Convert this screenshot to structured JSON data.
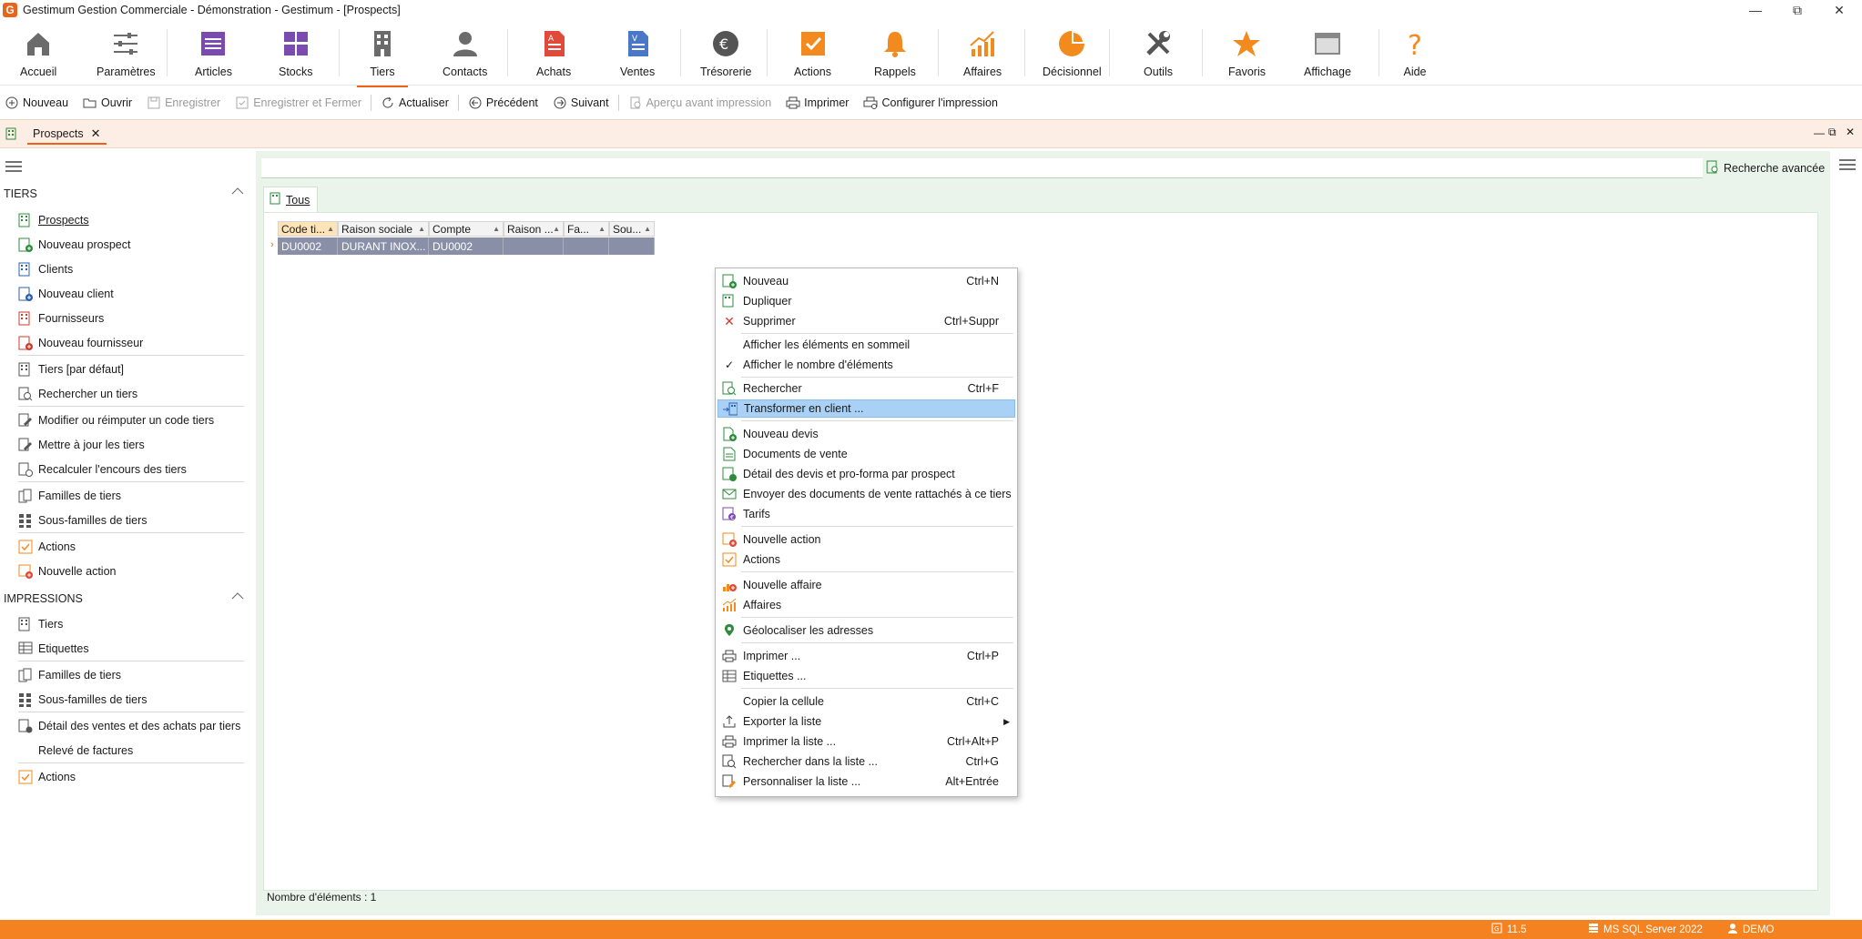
{
  "window": {
    "title": "Gestimum Gestion Commerciale - Démonstration - Gestimum - [Prospects]",
    "logo_letter": "G"
  },
  "ribbon": {
    "accueil": "Accueil",
    "parametres": "Paramètres",
    "articles": "Articles",
    "stocks": "Stocks",
    "tiers": "Tiers",
    "contacts": "Contacts",
    "achats": "Achats",
    "ventes": "Ventes",
    "tresorerie": "Trésorerie",
    "actions": "Actions",
    "rappels": "Rappels",
    "affaires": "Affaires",
    "decisionnel": "Décisionnel",
    "outils": "Outils",
    "favoris": "Favoris",
    "affichage": "Affichage",
    "aide": "Aide"
  },
  "toolbar": {
    "nouveau": "Nouveau",
    "ouvrir": "Ouvrir",
    "enregistrer": "Enregistrer",
    "enregistrer_fermer": "Enregistrer et Fermer",
    "actualiser": "Actualiser",
    "precedent": "Précédent",
    "suivant": "Suivant",
    "apercu": "Aperçu avant impression",
    "imprimer": "Imprimer",
    "configurer": "Configurer l'impression"
  },
  "doc_tab": {
    "label": "Prospects"
  },
  "sidebar": {
    "section_tiers": "TIERS",
    "section_impressions": "IMPRESSIONS",
    "tiers_items": {
      "prospects": "Prospects",
      "nouveau_prospect": "Nouveau prospect",
      "clients": "Clients",
      "nouveau_client": "Nouveau client",
      "fournisseurs": "Fournisseurs",
      "nouveau_fournisseur": "Nouveau fournisseur",
      "tiers_defaut": "Tiers [par défaut]",
      "rechercher_tiers": "Rechercher un tiers",
      "modifier_code": "Modifier ou réimputer un code tiers",
      "mettre_a_jour": "Mettre à jour les tiers",
      "recalculer": "Recalculer l'encours des tiers",
      "familles": "Familles de tiers",
      "sous_familles": "Sous-familles de tiers",
      "actions": "Actions",
      "nouvelle_action": "Nouvelle action"
    },
    "impressions_items": {
      "tiers": "Tiers",
      "etiquettes": "Etiquettes",
      "familles": "Familles de tiers",
      "sous_familles": "Sous-familles de tiers",
      "detail_ventes": "Détail des ventes et des achats par tiers",
      "releve": "Relevé de factures",
      "actions": "Actions"
    }
  },
  "search": {
    "advanced_label": "Recherche avancée"
  },
  "view_tab": {
    "label": "Tous"
  },
  "grid": {
    "columns": [
      "Code ti...",
      "Raison sociale",
      "Compte",
      "Raison ...",
      "Fa...",
      "Sou..."
    ],
    "row": [
      "DU0002",
      "DURANT INOX...",
      "DU0002",
      "",
      "",
      ""
    ]
  },
  "count_label": "Nombre d'éléments : 1",
  "context_menu": {
    "nouveau": {
      "label": "Nouveau",
      "shortcut": "Ctrl+N"
    },
    "dupliquer": {
      "label": "Dupliquer"
    },
    "supprimer": {
      "label": "Supprimer",
      "shortcut": "Ctrl+Suppr"
    },
    "afficher_sommeil": {
      "label": "Afficher les éléments en sommeil"
    },
    "afficher_nombre": {
      "label": "Afficher le nombre d'éléments"
    },
    "rechercher": {
      "label": "Rechercher",
      "shortcut": "Ctrl+F"
    },
    "transformer": {
      "label": "Transformer en client ..."
    },
    "nouveau_devis": {
      "label": "Nouveau devis"
    },
    "documents_vente": {
      "label": "Documents de vente"
    },
    "detail_devis": {
      "label": "Détail des devis et pro-forma par prospect"
    },
    "envoyer_documents": {
      "label": "Envoyer des documents de vente rattachés à ce tiers"
    },
    "tarifs": {
      "label": "Tarifs"
    },
    "nouvelle_action": {
      "label": "Nouvelle action"
    },
    "actions": {
      "label": "Actions"
    },
    "nouvelle_affaire": {
      "label": "Nouvelle affaire"
    },
    "affaires": {
      "label": "Affaires"
    },
    "geolocaliser": {
      "label": "Géolocaliser les adresses"
    },
    "imprimer": {
      "label": "Imprimer ...",
      "shortcut": "Ctrl+P"
    },
    "etiquettes": {
      "label": "Etiquettes ..."
    },
    "copier": {
      "label": "Copier la cellule",
      "shortcut": "Ctrl+C"
    },
    "exporter": {
      "label": "Exporter la liste"
    },
    "imprimer_liste": {
      "label": "Imprimer la liste ...",
      "shortcut": "Ctrl+Alt+P"
    },
    "rechercher_liste": {
      "label": "Rechercher dans la liste ...",
      "shortcut": "Ctrl+G"
    },
    "personnaliser": {
      "label": "Personnaliser la liste ...",
      "shortcut": "Alt+Entrée"
    }
  },
  "statusbar": {
    "version": "11.5",
    "server": "MS SQL Server 2022",
    "user": "DEMO"
  },
  "colors": {
    "accent": "#e8641a",
    "status": "#f58220",
    "menu_highlight": "#a8d1f5"
  }
}
